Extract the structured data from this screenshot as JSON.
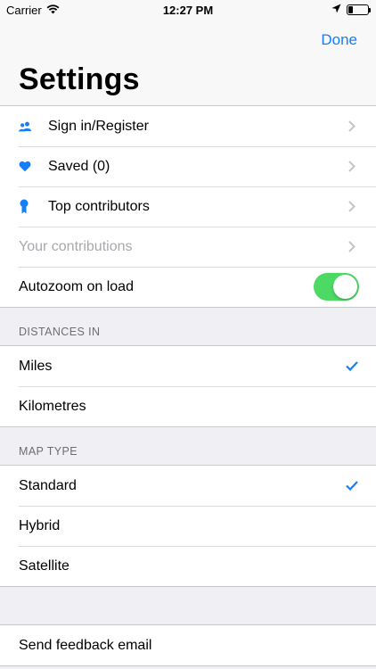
{
  "status_bar": {
    "carrier": "Carrier",
    "time": "12:27 PM",
    "battery_level": 0.25
  },
  "nav": {
    "done_label": "Done",
    "title": "Settings"
  },
  "account_group": {
    "items": [
      {
        "label": "Sign in/Register",
        "icon": "users-icon"
      },
      {
        "label": "Saved (0)",
        "icon": "heart-icon"
      },
      {
        "label": "Top contributors",
        "icon": "ribbon-icon"
      },
      {
        "label": "Your contributions",
        "disabled": true
      },
      {
        "label": "Autozoom on load",
        "toggle_on": true
      }
    ]
  },
  "distances": {
    "header": "DISTANCES IN",
    "options": [
      {
        "label": "Miles",
        "selected": true
      },
      {
        "label": "Kilometres",
        "selected": false
      }
    ]
  },
  "map_type": {
    "header": "MAP TYPE",
    "options": [
      {
        "label": "Standard",
        "selected": true
      },
      {
        "label": "Hybrid",
        "selected": false
      },
      {
        "label": "Satellite",
        "selected": false
      }
    ]
  },
  "feedback": {
    "label": "Send feedback email"
  },
  "colors": {
    "accent": "#147efb",
    "toggle_on": "#4cd964"
  }
}
